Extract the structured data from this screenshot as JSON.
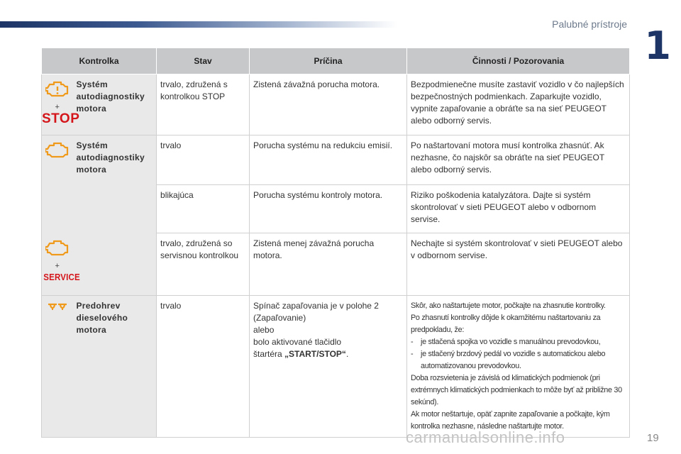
{
  "header": {
    "section_title": "Palubné prístroje",
    "chapter": "1"
  },
  "table": {
    "columns": [
      "Kontrolka",
      "Stav",
      "Príčina",
      "Činnosti / Pozorovania"
    ],
    "rows": [
      {
        "name": "Systém autodiagnostiky motora",
        "state": "trvalo, združená s kontrolkou STOP",
        "cause": "Zistená závažná porucha motora.",
        "action": "Bezpodmienečne musíte zastaviť vozidlo v čo najlepších bezpečnostných podmienkach. Zaparkujte vozidlo, vypnite zapaľovanie a obráťte sa na sieť PEUGEOT alebo odborný servis."
      },
      {
        "name": "Systém autodiagnostiky motora",
        "state": "trvalo",
        "cause": "Porucha systému na redukciu emisií.",
        "action": "Po naštartovaní motora musí kontrolka zhasnúť. Ak nezhasne, čo najskôr sa obráťte na sieť PEUGEOT alebo odborný servis."
      },
      {
        "state": "blikajúca",
        "cause": "Porucha systému kontroly motora.",
        "action": "Riziko poškodenia katalyzátora. Dajte si systém skontrolovať v sieti PEUGEOT alebo v odbornom servise."
      },
      {
        "state": "trvalo, združená so servisnou kontrolkou",
        "cause": "Zistená menej závažná porucha motora.",
        "action": "Nechajte si systém skontrolovať v sieti PEUGEOT alebo v odbornom servise."
      },
      {
        "name": "Predohrev dieselového motora",
        "state": "trvalo",
        "cause_lines": [
          "Spínač zapaľovania je v polohe 2",
          "(Zapaľovanie)",
          "alebo",
          "bolo aktivované tlačidlo",
          "štartéra "
        ],
        "cause_bold": "„START/STOP“",
        "cause_end": ".",
        "action_lines": [
          "Skôr, ako naštartujete motor, počkajte na zhasnutie kontrolky.",
          "Po zhasnutí kontrolky dôjde k okamžitému naštartovaniu za predpokladu, že:"
        ],
        "action_bullets": [
          "je stlačená spojka vo vozidle s manuálnou prevodovkou,",
          "je stlačený brzdový pedál vo vozidle s automatickou alebo automatizovanou prevodovkou."
        ],
        "action_tail": [
          "Doba rozsvietenia je závislá od klimatických podmienok (pri extrémnych klimatických podmienkach to môže byť až približne 30 sekúnd).",
          "Ak motor neštartuje, opäť zapnite zapaľovanie a počkajte, kým kontrolka nezhasne, následne naštartujte motor."
        ]
      }
    ]
  },
  "icons": {
    "plus": "+",
    "stop": "STOP",
    "service": "SERVICE"
  },
  "colors": {
    "icon_orange": "#f09a1b",
    "stop_red": "#d4161b",
    "header_bg": "#c7c8ca",
    "label_bg": "#e9e9ea"
  },
  "footer": {
    "page_number": "19",
    "watermark": "carmanualsonline.info"
  }
}
